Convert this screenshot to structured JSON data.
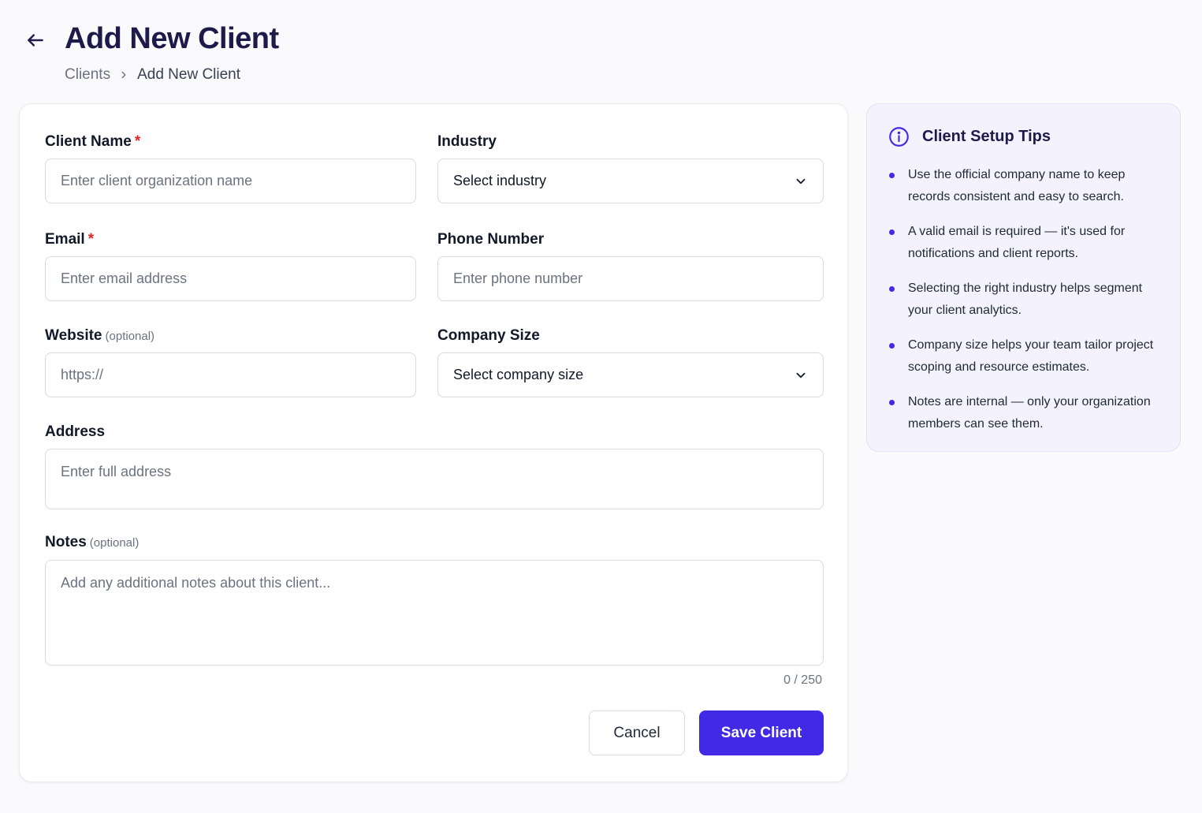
{
  "header": {
    "title": "Add New Client",
    "breadcrumb": {
      "parent": "Clients",
      "current": "Add New Client"
    }
  },
  "form": {
    "client_name": {
      "label": "Client Name",
      "required_mark": "*",
      "placeholder": "Enter client organization name",
      "value": ""
    },
    "industry": {
      "label": "Industry",
      "selected": "Select industry"
    },
    "email": {
      "label": "Email",
      "required_mark": "*",
      "placeholder": "Enter email address",
      "value": ""
    },
    "phone": {
      "label": "Phone Number",
      "placeholder": "Enter phone number",
      "value": ""
    },
    "website": {
      "label": "Website",
      "optional": "(optional)",
      "placeholder": "https://",
      "value": ""
    },
    "company_size": {
      "label": "Company Size",
      "selected": "Select company size"
    },
    "address": {
      "label": "Address",
      "placeholder": "Enter full address",
      "value": ""
    },
    "notes": {
      "label": "Notes",
      "optional": "(optional)",
      "placeholder": "Add any additional notes about this client...",
      "value": "",
      "counter": "0 / 250"
    },
    "buttons": {
      "cancel": "Cancel",
      "save": "Save Client"
    }
  },
  "tips": {
    "title": "Client Setup Tips",
    "items": [
      "Use the official company name to keep records consistent and easy to search.",
      "A valid email is required — it's used for notifications and client reports.",
      "Selecting the right industry helps segment your client analytics.",
      "Company size helps your team tailor project scoping and resource estimates.",
      "Notes are internal — only your organization members can see them."
    ]
  },
  "colors": {
    "primary": "#4129e6",
    "title": "#1e1b4b",
    "required": "#dc2626",
    "tips_background": "#f3f2fd"
  },
  "icons": {
    "back": "arrow-left-icon",
    "breadcrumb_separator": "chevron-right-icon",
    "select": "chevron-down-icon",
    "tips": "info-circle-icon"
  }
}
